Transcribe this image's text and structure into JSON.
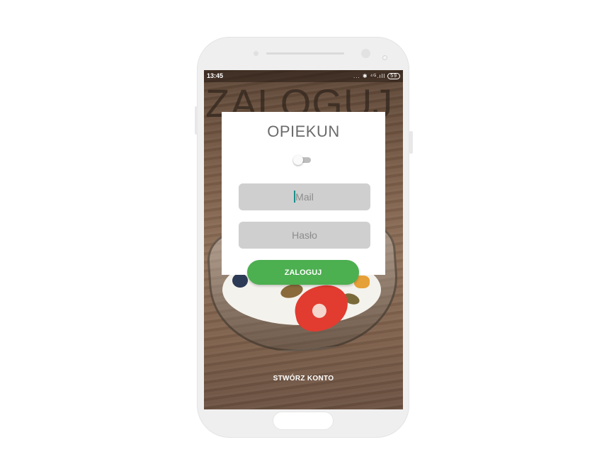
{
  "status_bar": {
    "time": "13:45",
    "icons": "... ✱ ⁴ᴳ.ıll",
    "battery": "59"
  },
  "screen": {
    "background_title": "ZALOGUJ"
  },
  "login_card": {
    "title": "OPIEKUN",
    "toggle_on": false,
    "mail_placeholder": "Mail",
    "password_placeholder": "Hasło"
  },
  "actions": {
    "login_label": "ZALOGUJ",
    "create_account_label": "STWÓRZ KONTO"
  },
  "colors": {
    "accent": "#4caf50",
    "field_bg": "#cfcfcf",
    "title_text": "#6b6b6b"
  }
}
